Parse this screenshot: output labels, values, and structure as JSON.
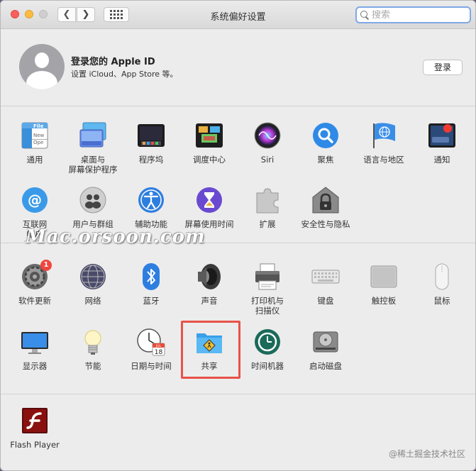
{
  "window": {
    "title": "系统偏好设置"
  },
  "search": {
    "placeholder": "搜索"
  },
  "account": {
    "title": "登录您的 Apple ID",
    "subtitle": "设置 iCloud、App Store 等。",
    "login_button": "登录"
  },
  "row1": [
    {
      "label": "通用",
      "icon": "general-icon"
    },
    {
      "label": "桌面与\n屏幕保护程序",
      "icon": "desktop-icon"
    },
    {
      "label": "程序坞",
      "icon": "dock-icon"
    },
    {
      "label": "调度中心",
      "icon": "mission-control-icon"
    },
    {
      "label": "Siri",
      "icon": "siri-icon"
    },
    {
      "label": "聚焦",
      "icon": "spotlight-icon"
    },
    {
      "label": "语言与地区",
      "icon": "language-region-icon"
    },
    {
      "label": "通知",
      "icon": "notifications-icon"
    }
  ],
  "row2": [
    {
      "label": "互联网\n帐户",
      "icon": "internet-accounts-icon"
    },
    {
      "label": "用户与群组",
      "icon": "users-groups-icon"
    },
    {
      "label": "辅助功能",
      "icon": "accessibility-icon"
    },
    {
      "label": "屏幕使用时间",
      "icon": "screen-time-icon"
    },
    {
      "label": "扩展",
      "icon": "extensions-icon"
    },
    {
      "label": "安全性与隐私",
      "icon": "security-privacy-icon"
    }
  ],
  "row3": [
    {
      "label": "软件更新",
      "icon": "software-update-icon",
      "badge": "1"
    },
    {
      "label": "网络",
      "icon": "network-icon"
    },
    {
      "label": "蓝牙",
      "icon": "bluetooth-icon"
    },
    {
      "label": "声音",
      "icon": "sound-icon"
    },
    {
      "label": "打印机与\n扫描仪",
      "icon": "printers-icon"
    },
    {
      "label": "键盘",
      "icon": "keyboard-icon"
    },
    {
      "label": "触控板",
      "icon": "trackpad-icon"
    },
    {
      "label": "鼠标",
      "icon": "mouse-icon"
    }
  ],
  "row4": [
    {
      "label": "显示器",
      "icon": "displays-icon"
    },
    {
      "label": "节能",
      "icon": "energy-saver-icon"
    },
    {
      "label": "日期与时间",
      "icon": "date-time-icon",
      "calendar_month": "JUL",
      "calendar_day": "18"
    },
    {
      "label": "共享",
      "icon": "sharing-icon"
    },
    {
      "label": "时间机器",
      "icon": "time-machine-icon"
    },
    {
      "label": "启动磁盘",
      "icon": "startup-disk-icon"
    }
  ],
  "other": [
    {
      "label": "Flash Player",
      "icon": "flash-player-icon"
    }
  ],
  "general_icon_text": {
    "line1": "File",
    "line2": "New",
    "line3": "Ope"
  },
  "watermark": "Mac.orsoon.com",
  "credit": "@稀土掘金技术社区",
  "colors": {
    "accent": "#7fa8e5",
    "highlight": "#e8524a",
    "badge": "#f1453d"
  }
}
